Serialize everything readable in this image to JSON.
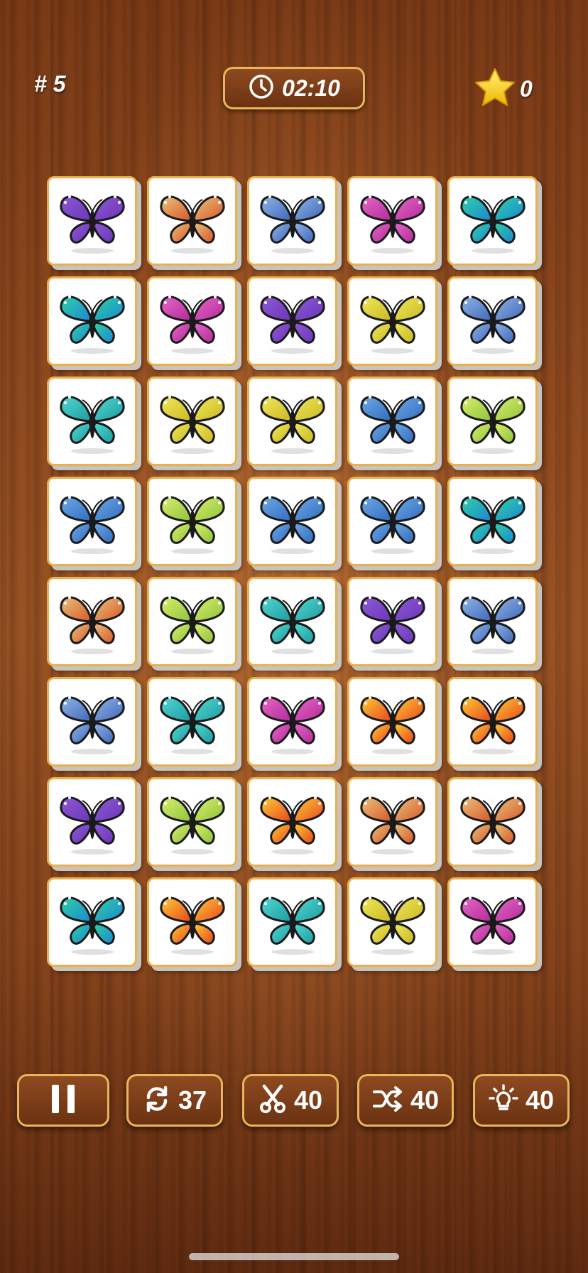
{
  "header": {
    "level_label": "# 5",
    "timer": "02:10",
    "stars": "0"
  },
  "icons": {
    "timer": "clock-icon",
    "stars": "star-icon",
    "pause": "pause-icon",
    "refresh": "refresh-icon",
    "cut": "scissors-icon",
    "shuffle": "shuffle-icon",
    "hint": "lightbulb-icon"
  },
  "colors": {
    "purple": [
      "#8e5ad6",
      "#6a35b8"
    ],
    "orange-cream": [
      "#e9c27a",
      "#d9572a"
    ],
    "light-blue": [
      "#8fb3e8",
      "#3f68b8"
    ],
    "magenta": [
      "#e667c9",
      "#b32a98"
    ],
    "teal": [
      "#2fd2a6",
      "#1b86d3"
    ],
    "yellow": [
      "#f1e85a",
      "#c9b822"
    ],
    "blue": [
      "#6fa7e6",
      "#2f6dbf"
    ],
    "lime": [
      "#d9ef6e",
      "#8fc23a"
    ],
    "cyan": [
      "#4fd9d2",
      "#1f9a9f"
    ],
    "fire": [
      "#ffcc33",
      "#e8451f"
    ]
  },
  "board": {
    "rows": [
      [
        "purple",
        "orange-cream",
        "light-blue",
        "magenta",
        "teal"
      ],
      [
        "teal",
        "magenta",
        "purple",
        "yellow",
        "light-blue"
      ],
      [
        "cyan",
        "yellow",
        "yellow",
        "blue",
        "lime"
      ],
      [
        "blue",
        "lime",
        "blue",
        "blue",
        "teal"
      ],
      [
        "orange-cream",
        "lime",
        "cyan",
        "purple",
        "light-blue"
      ],
      [
        "light-blue",
        "cyan",
        "magenta",
        "fire",
        "fire"
      ],
      [
        "purple",
        "lime",
        "fire",
        "orange-cream",
        "orange-cream"
      ],
      [
        "teal",
        "fire",
        "cyan",
        "yellow",
        "magenta"
      ]
    ]
  },
  "toolbar": {
    "refresh_count": "37",
    "cut_count": "40",
    "shuffle_count": "40",
    "hint_count": "40"
  }
}
